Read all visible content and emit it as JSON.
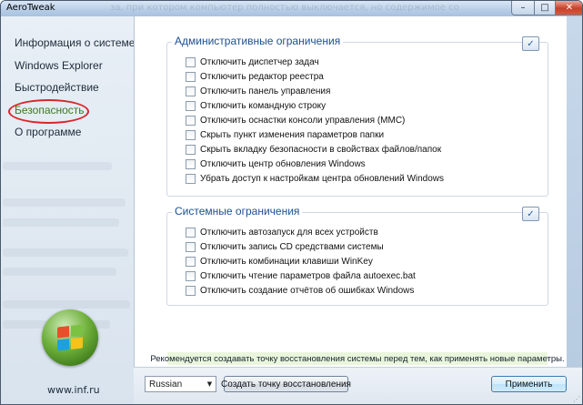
{
  "window": {
    "title": "AeroTweak",
    "background_text": "за, при котором компьютер полностью выключается, но содержимое со",
    "controls": {
      "minimize": "–",
      "maximize": "□",
      "close": "✕"
    }
  },
  "sidebar": {
    "items": [
      {
        "label": "Информация о системе",
        "active": false
      },
      {
        "label": "Windows Explorer",
        "active": false
      },
      {
        "label": "Быстродействие",
        "active": false
      },
      {
        "label": "Безопасность",
        "active": true
      },
      {
        "label": "О программе",
        "active": false
      }
    ],
    "logo_icon": "windows-flag-orb-icon",
    "site_url": "www.inf.ru"
  },
  "groups": {
    "admin": {
      "title": "Административные ограничения",
      "toggle_icon": "check-all-icon",
      "options": [
        {
          "label": "Отключить диспетчер задач",
          "checked": false
        },
        {
          "label": "Отключить редактор реестра",
          "checked": false
        },
        {
          "label": "Отключить панель управления",
          "checked": false
        },
        {
          "label": "Отключить командную строку",
          "checked": false
        },
        {
          "label": "Отключить оснастки консоли управления (MMC)",
          "checked": false
        },
        {
          "label": "Скрыть пункт изменения параметров папки",
          "checked": false
        },
        {
          "label": "Скрыть вкладку безопасности в свойствах файлов/папок",
          "checked": false
        },
        {
          "label": "Отключить центр обновления Windows",
          "checked": false
        },
        {
          "label": "Убрать доступ к настройкам центра обновлений Windows",
          "checked": false
        }
      ]
    },
    "system": {
      "title": "Системные ограничения",
      "toggle_icon": "check-all-icon",
      "options": [
        {
          "label": "Отключить автозапуск для всех устройств",
          "checked": false
        },
        {
          "label": "Отключить запись CD средствами системы",
          "checked": false
        },
        {
          "label": "Отключить комбинации клавиши WinKey",
          "checked": false
        },
        {
          "label": "Отключить чтение параметров файла autoexec.bat",
          "checked": false
        },
        {
          "label": "Отключить создание отчётов об ошибках Windows",
          "checked": false
        }
      ]
    }
  },
  "notice": "Рекомендуется создавать точку восстановления системы перед тем, как применять новые параметры.",
  "footer": {
    "language_selected": "Russian",
    "restore_button": "Создать точку восстановления",
    "apply_button": "Применить"
  },
  "colors": {
    "accent_title": "#1d4f91",
    "active_nav": "#3d7a1e",
    "highlight_ring": "#d9262a",
    "notice_bg": "#eaf6dc"
  }
}
